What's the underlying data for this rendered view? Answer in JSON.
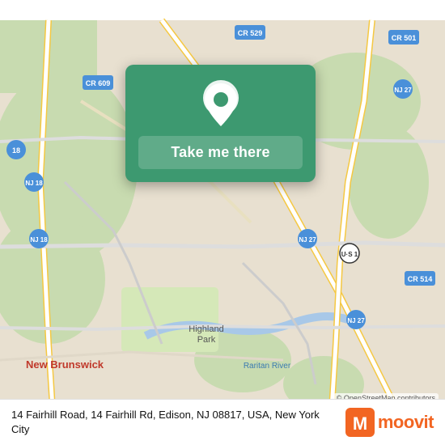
{
  "map": {
    "alt": "Street map of Edison and New Brunswick, NJ area"
  },
  "card": {
    "button_label": "Take me there"
  },
  "bottom_bar": {
    "address": "14 Fairhill Road, 14 Fairhill Rd, Edison, NJ 08817, USA, New York City"
  },
  "attribution": {
    "text": "© OpenStreetMap contributors"
  },
  "moovit": {
    "logo_text": "moovit"
  },
  "colors": {
    "card_green": "#3d9970",
    "moovit_orange": "#f26522"
  }
}
